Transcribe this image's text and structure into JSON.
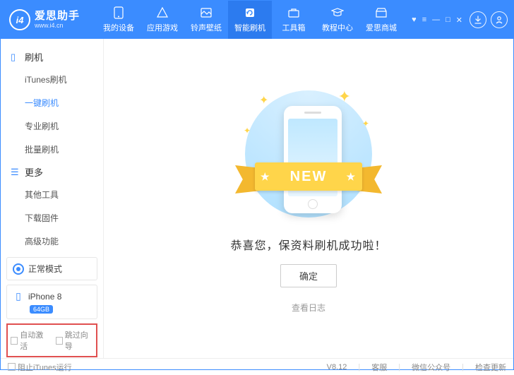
{
  "app": {
    "name": "爱思助手",
    "url": "www.i4.cn",
    "logo_text": "i4"
  },
  "nav": [
    {
      "label": "我的设备"
    },
    {
      "label": "应用游戏"
    },
    {
      "label": "铃声壁纸"
    },
    {
      "label": "智能刷机"
    },
    {
      "label": "工具箱"
    },
    {
      "label": "教程中心"
    },
    {
      "label": "爱思商城"
    }
  ],
  "sidebar": {
    "flash_header": "刷机",
    "flash_items": [
      "iTunes刷机",
      "一键刷机",
      "专业刷机",
      "批量刷机"
    ],
    "more_header": "更多",
    "more_items": [
      "其他工具",
      "下载固件",
      "高级功能"
    ]
  },
  "mode": {
    "label": "正常模式"
  },
  "device": {
    "name": "iPhone 8",
    "storage": "64GB"
  },
  "checks": {
    "auto_activate": "自动激活",
    "skip_guide": "跳过向导"
  },
  "main": {
    "ribbon": "NEW",
    "success": "恭喜您，保资料刷机成功啦！",
    "ok": "确定",
    "view_log": "查看日志"
  },
  "footer": {
    "block_itunes": "阻止iTunes运行",
    "version": "V8.12",
    "support": "客服",
    "wechat": "微信公众号",
    "update": "检查更新"
  }
}
